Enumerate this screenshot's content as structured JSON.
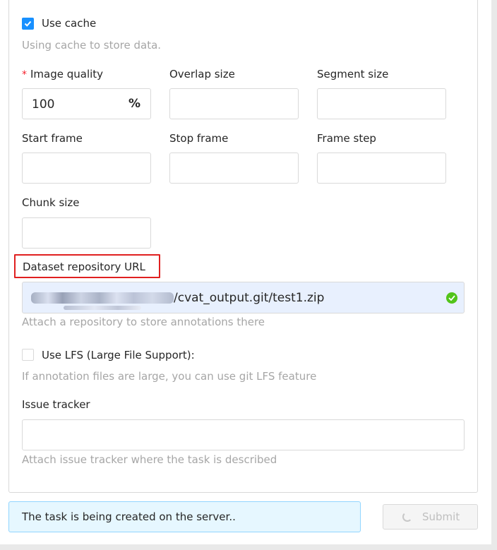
{
  "cache": {
    "checked": true,
    "label": "Use cache",
    "hint": "Using cache to store data."
  },
  "fields": {
    "image_quality": {
      "required": "*",
      "label": "Image quality",
      "value": "100",
      "suffix": "%"
    },
    "overlap_size": {
      "label": "Overlap size",
      "value": ""
    },
    "segment_size": {
      "label": "Segment size",
      "value": ""
    },
    "start_frame": {
      "label": "Start frame",
      "value": ""
    },
    "stop_frame": {
      "label": "Stop frame",
      "value": ""
    },
    "frame_step": {
      "label": "Frame step",
      "value": ""
    },
    "chunk_size": {
      "label": "Chunk size",
      "value": ""
    }
  },
  "repository": {
    "label": "Dataset repository URL",
    "value_visible": "/cvat_output.git/test1.zip",
    "hint": "Attach a repository to store annotations there",
    "status_icon": "check-circle-icon",
    "highlight_color": "#e02020"
  },
  "lfs": {
    "checked": false,
    "label": "Use LFS (Large File Support):",
    "hint": "If annotation files are large, you can use git LFS feature"
  },
  "issue_tracker": {
    "label": "Issue tracker",
    "value": "",
    "hint": "Attach issue tracker where the task is described"
  },
  "status": {
    "message": "The task is being created on the server.."
  },
  "submit": {
    "label": "Submit",
    "loading": true,
    "icon": "loading-spinner-icon"
  },
  "colors": {
    "primary": "#1890ff",
    "success": "#52c41a",
    "alert_bg": "#e6f7ff",
    "alert_border": "#91d5ff"
  }
}
